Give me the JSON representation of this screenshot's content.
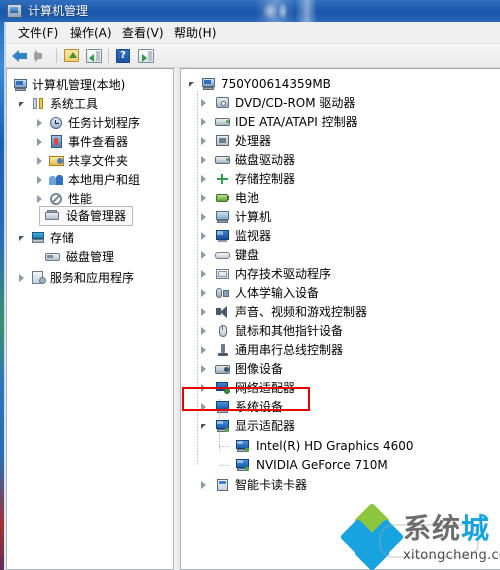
{
  "window": {
    "title": "计算机管理",
    "icon": "computer-management-icon"
  },
  "menubar": {
    "items": [
      {
        "label": "文件(F)",
        "name": "menu-file"
      },
      {
        "label": "操作(A)",
        "name": "menu-action"
      },
      {
        "label": "查看(V)",
        "name": "menu-view"
      },
      {
        "label": "帮助(H)",
        "name": "menu-help"
      }
    ]
  },
  "toolbar": {
    "buttons": [
      {
        "name": "back-button",
        "icon": "arrow-left-icon"
      },
      {
        "name": "forward-button",
        "icon": "arrow-right-icon"
      },
      {
        "name": "up-one-level-button",
        "icon": "folder-up-icon"
      },
      {
        "name": "show-hide-console-tree-button",
        "icon": "console-tree-icon"
      },
      {
        "name": "help-button",
        "icon": "question-mark-icon",
        "glyph": "?"
      },
      {
        "name": "show-hide-action-pane-button",
        "icon": "action-pane-icon"
      }
    ]
  },
  "left_tree": {
    "items": [
      {
        "label": "计算机管理(本地)",
        "icon": "computer-management-root-icon",
        "indent": 0,
        "expander": "none",
        "selected": false
      },
      {
        "label": "系统工具",
        "icon": "system-tools-icon",
        "indent": 1,
        "expander": "open",
        "selected": false
      },
      {
        "label": "任务计划程序",
        "icon": "task-scheduler-icon",
        "indent": 2,
        "expander": "closed",
        "selected": false
      },
      {
        "label": "事件查看器",
        "icon": "event-viewer-icon",
        "indent": 2,
        "expander": "closed",
        "selected": false
      },
      {
        "label": "共享文件夹",
        "icon": "shared-folders-icon",
        "indent": 2,
        "expander": "closed",
        "selected": false
      },
      {
        "label": "本地用户和组",
        "icon": "local-users-groups-icon",
        "indent": 2,
        "expander": "closed",
        "selected": false
      },
      {
        "label": "性能",
        "icon": "performance-icon",
        "indent": 2,
        "expander": "closed",
        "selected": false
      },
      {
        "label": "设备管理器",
        "icon": "device-manager-icon",
        "indent": 2,
        "expander": "none",
        "selected": true
      },
      {
        "label": "存储",
        "icon": "storage-icon",
        "indent": 1,
        "expander": "open",
        "selected": false
      },
      {
        "label": "磁盘管理",
        "icon": "disk-management-icon",
        "indent": 2,
        "expander": "none",
        "selected": false
      },
      {
        "label": "服务和应用程序",
        "icon": "services-applications-icon",
        "indent": 1,
        "expander": "closed",
        "selected": false
      }
    ]
  },
  "right_tree": {
    "items": [
      {
        "label": "750Y00614359MB",
        "icon": "computer-root-icon",
        "indent": 0,
        "expander": "open",
        "highlighted": false
      },
      {
        "label": "DVD/CD-ROM 驱动器",
        "icon": "dvd-cdrom-icon",
        "indent": 1,
        "expander": "closed",
        "highlighted": false
      },
      {
        "label": "IDE ATA/ATAPI 控制器",
        "icon": "ide-controller-icon",
        "indent": 1,
        "expander": "closed",
        "highlighted": false
      },
      {
        "label": "处理器",
        "icon": "processor-icon",
        "indent": 1,
        "expander": "closed",
        "highlighted": false
      },
      {
        "label": "磁盘驱动器",
        "icon": "disk-drive-icon",
        "indent": 1,
        "expander": "closed",
        "highlighted": false
      },
      {
        "label": "存储控制器",
        "icon": "storage-controller-icon",
        "indent": 1,
        "expander": "closed",
        "highlighted": false
      },
      {
        "label": "电池",
        "icon": "battery-icon",
        "indent": 1,
        "expander": "closed",
        "highlighted": false
      },
      {
        "label": "计算机",
        "icon": "computer-icon",
        "indent": 1,
        "expander": "closed",
        "highlighted": false
      },
      {
        "label": "监视器",
        "icon": "monitor-icon",
        "indent": 1,
        "expander": "closed",
        "highlighted": false
      },
      {
        "label": "键盘",
        "icon": "keyboard-icon",
        "indent": 1,
        "expander": "closed",
        "highlighted": false
      },
      {
        "label": "内存技术驱动程序",
        "icon": "memory-technology-driver-icon",
        "indent": 1,
        "expander": "closed",
        "highlighted": false
      },
      {
        "label": "人体学输入设备",
        "icon": "human-interface-device-icon",
        "indent": 1,
        "expander": "closed",
        "highlighted": false
      },
      {
        "label": "声音、视频和游戏控制器",
        "icon": "sound-video-game-icon",
        "indent": 1,
        "expander": "closed",
        "highlighted": false
      },
      {
        "label": "鼠标和其他指针设备",
        "icon": "mouse-pointing-device-icon",
        "indent": 1,
        "expander": "closed",
        "highlighted": false
      },
      {
        "label": "通用串行总线控制器",
        "icon": "usb-controller-icon",
        "indent": 1,
        "expander": "closed",
        "highlighted": false
      },
      {
        "label": "图像设备",
        "icon": "imaging-device-icon",
        "indent": 1,
        "expander": "closed",
        "highlighted": false
      },
      {
        "label": "网络适配器",
        "icon": "network-adapter-icon",
        "indent": 1,
        "expander": "closed",
        "highlighted": false
      },
      {
        "label": "系统设备",
        "icon": "system-device-icon",
        "indent": 1,
        "expander": "closed",
        "highlighted": false
      },
      {
        "label": "显示适配器",
        "icon": "display-adapter-icon",
        "indent": 1,
        "expander": "open",
        "highlighted": true
      },
      {
        "label": "Intel(R) HD Graphics 4600",
        "icon": "display-adapter-child-icon",
        "indent": 2,
        "expander": "none",
        "highlighted": false
      },
      {
        "label": "NVIDIA GeForce 710M",
        "icon": "display-adapter-child-icon",
        "indent": 2,
        "expander": "none",
        "highlighted": false
      },
      {
        "label": "智能卡读卡器",
        "icon": "smart-card-reader-icon",
        "indent": 1,
        "expander": "closed",
        "highlighted": false
      }
    ]
  },
  "annotation": {
    "color": "#e80000",
    "target_label": "显示适配器"
  },
  "watermark": {
    "cn_left": "系统",
    "cn_right": "城",
    "domain": "xitongcheng.com"
  },
  "colors": {
    "titlebar": "#1d5aad",
    "accent": "#2f6fbe",
    "annotation": "#e80000",
    "watermark_blue": "#17a3e0",
    "watermark_green": "#8cc63f"
  }
}
